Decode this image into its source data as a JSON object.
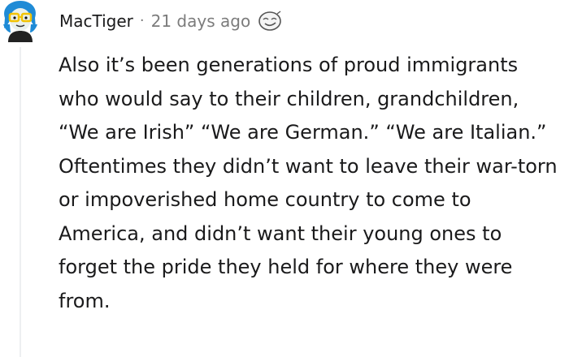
{
  "comment": {
    "username": "MacTiger",
    "separator": "·",
    "timestamp": "21 days ago",
    "body": "Also it’s been generations of proud immigrants who would say to their children, grandchildren, “We are Irish” “We are German.” “We are Italian.” Oftentimes they didn’t want to leave their war-torn or impoverished home country to come to America, and didn’t want their young ones to forget the pride they held for where they were from."
  },
  "icons": {
    "avatar": "user-avatar",
    "award": "award-icon"
  },
  "colors": {
    "text": "#1a1a1b",
    "meta": "#7c7c7c",
    "avatar_hair": "#1f8bd6",
    "avatar_glasses": "#f2c200"
  }
}
